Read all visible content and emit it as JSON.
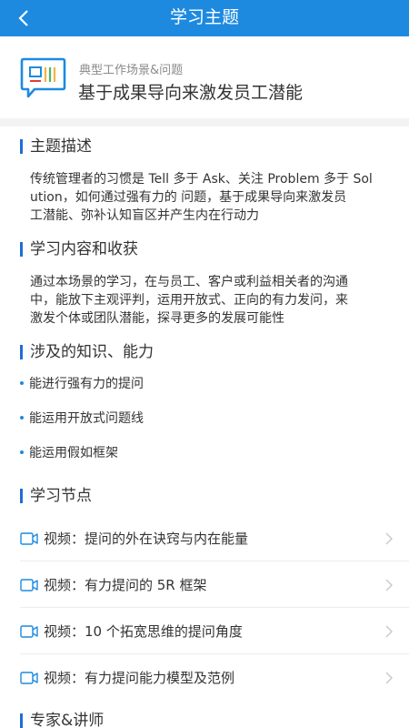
{
  "navbar": {
    "title": "学习主题"
  },
  "header": {
    "subtitle": "典型工作场景&问题",
    "title": "基于成果导向来激发员工潜能"
  },
  "sections": {
    "description": {
      "title": "主题描述",
      "lines": [
        "传统管理者的习惯是 Tell 多于 Ask、关注 Problem 多于 Sol",
        "ution，如何通过强有力的 问题，基于成果导向来激发员",
        "工潜能、弥补认知盲区并产生内在行动力"
      ]
    },
    "gains": {
      "title": "学习内容和收获",
      "lines": [
        "通过本场景的学习，在与员工、客户或利益相关者的沟通",
        "中，能放下主观评判，运用开放式、正向的有力发问，来",
        "激发个体或团队潜能，探寻更多的发展可能性"
      ]
    },
    "skills": {
      "title": "涉及的知识、能力",
      "items": [
        "能进行强有力的提问",
        "能运用开放式问题线",
        "能运用假如框架"
      ]
    },
    "nodes": {
      "title": "学习节点",
      "items": [
        "视频：提问的外在诀窍与内在能量",
        "视频：有力提问的 5R 框架",
        "视频：10 个拓宽思维的提问角度",
        "视频：有力提问能力模型及范例"
      ]
    },
    "experts": {
      "title": "专家&讲师"
    }
  },
  "colors": {
    "primary": "#1d8ae0",
    "accent_bar": "#1d6fd6"
  }
}
